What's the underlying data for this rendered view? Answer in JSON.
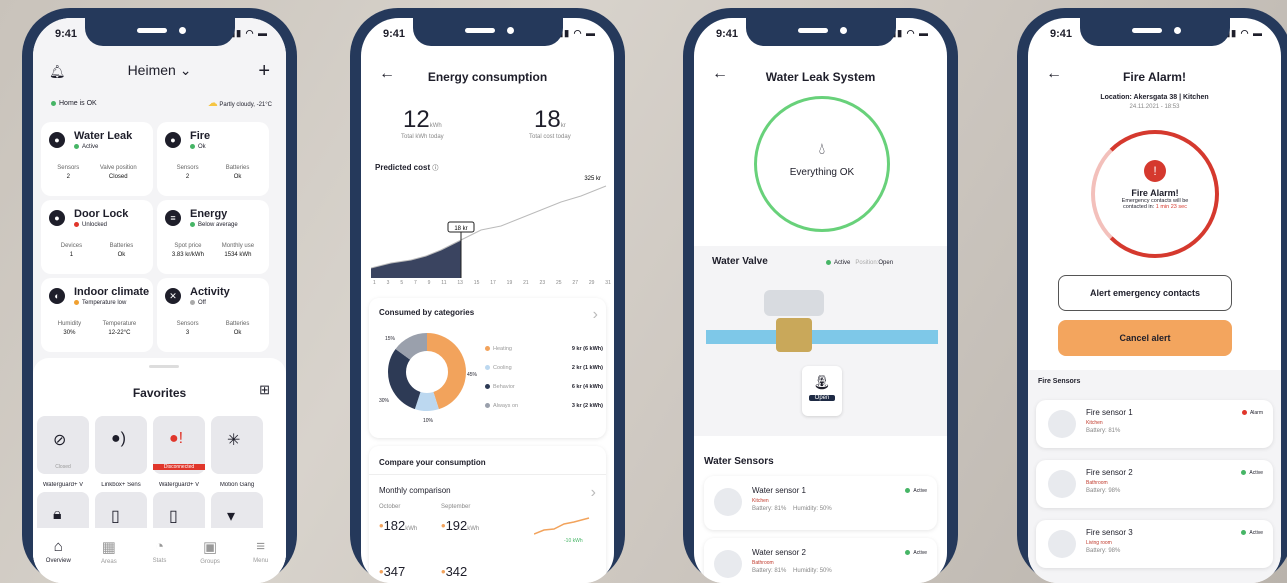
{
  "status_time": "9:41",
  "p1": {
    "title": "Heimen",
    "home": "Home is OK",
    "weather": "Partly cloudy, -21°C",
    "tiles": [
      {
        "name": "Water Leak",
        "status": "Active",
        "color": "#46b566",
        "c1": "Sensors",
        "v1": "2",
        "c2": "Valve position",
        "v2": "Closed",
        "icon": "water-drop-icon",
        "glyph": "●"
      },
      {
        "name": "Fire",
        "status": "Ok",
        "color": "#46b566",
        "c1": "Sensors",
        "v1": "2",
        "c2": "Batteries",
        "v2": "Ok",
        "icon": "fire-icon",
        "glyph": "●"
      },
      {
        "name": "Door Lock",
        "status": "Unlocked",
        "color": "#e0362b",
        "c1": "Devices",
        "v1": "1",
        "c2": "Batteries",
        "v2": "Ok",
        "icon": "lock-icon",
        "glyph": "●"
      },
      {
        "name": "Energy",
        "status": "Below average",
        "color": "#46b566",
        "c1": "Spot price",
        "v1": "3.83 kr/kWh",
        "c2": "Monthly use",
        "v2": "1534 kWh",
        "icon": "energy-icon",
        "glyph": "≡"
      },
      {
        "name": "Indoor climate",
        "status": "Temperature low",
        "color": "#f0a030",
        "c1": "Humidity",
        "v1": "30%",
        "c2": "Temperature",
        "v2": "12-22°C",
        "icon": "climate-icon",
        "glyph": "◐"
      },
      {
        "name": "Activity",
        "status": "Off",
        "color": "#aaaaaa",
        "c1": "Sensors",
        "v1": "3",
        "c2": "Batteries",
        "v2": "Ok",
        "icon": "activity-icon",
        "glyph": "✕"
      }
    ],
    "favorites_title": "Favorites",
    "favs": [
      {
        "label": "Waterguard+ V",
        "sub": "Closed"
      },
      {
        "label": "Linkbox+ Sens",
        "sub": ""
      },
      {
        "label": "Waterguard+ V",
        "sub": "Disconnected"
      },
      {
        "label": "Motion Gang",
        "sub": ""
      }
    ],
    "nav": [
      "Overview",
      "Areas",
      "Stats",
      "Groups",
      "Menu"
    ]
  },
  "p2": {
    "title": "Energy consumption",
    "kwh": "12",
    "kwh_unit": "kWh",
    "kwh_label": "Total kWh today",
    "kr": "18",
    "kr_unit": "kr",
    "kr_label": "Total cost today",
    "predicted": "Predicted cost",
    "max_label": "325 kr",
    "cur_label": "18 kr",
    "xticks": [
      "1",
      "3",
      "5",
      "7",
      "9",
      "11",
      "13",
      "15",
      "17",
      "19",
      "21",
      "23",
      "25",
      "27",
      "29",
      "31"
    ],
    "cat_title": "Consumed by categories",
    "cats": [
      {
        "name": "Heating",
        "val": "9 kr (6 kWh)",
        "pct": "45%",
        "color": "#f2a35c"
      },
      {
        "name": "Cooling",
        "val": "2 kr (1 kWh)",
        "pct": "10%",
        "color": "#bcd8f0"
      },
      {
        "name": "Behavior",
        "val": "6 kr (4 kWh)",
        "pct": "30%",
        "color": "#2d3a55"
      },
      {
        "name": "Always on",
        "val": "3 kr (2 kWh)",
        "pct": "15%",
        "color": "#9aa0ac"
      }
    ],
    "compare_title": "Compare your consumption",
    "monthly": "Monthly comparison",
    "m1": "October",
    "m2": "September",
    "v1": "182",
    "v2": "192",
    "unit": "kWh",
    "diff": "-10 kWh",
    "v3": "347",
    "v4": "342"
  },
  "p3": {
    "title": "Water Leak System",
    "ok": "Everything OK",
    "valve": "Water Valve",
    "active": "Active",
    "position_label": "Position:",
    "position": "Open",
    "open_btn": "Open",
    "sensors_title": "Water Sensors",
    "sensors": [
      {
        "name": "Water sensor 1",
        "room": "Kitchen",
        "battery": "Battery: 81%",
        "humidity": "Humidity: 50%",
        "status": "Active"
      },
      {
        "name": "Water sensor 2",
        "room": "Bathroom",
        "battery": "Battery: 81%",
        "humidity": "Humidity: 50%",
        "status": "Active"
      }
    ]
  },
  "p4": {
    "title": "Fire Alarm!",
    "location": "Location: Akersgata 38 | Kitchen",
    "datetime": "24.11.2021 - 18:53",
    "alarm": "Fire Alarm!",
    "msg": "Emergency contacts will be contacted in:",
    "countdown": "1 min 23 sec",
    "alert_btn": "Alert emergency contacts",
    "cancel_btn": "Cancel alert",
    "sensors_title": "Fire Sensors",
    "sensors": [
      {
        "name": "Fire sensor 1",
        "room": "Kitchen",
        "battery": "Battery: 81%",
        "status": "Alarm",
        "color": "#e0362b"
      },
      {
        "name": "Fire sensor 2",
        "room": "Bathroom",
        "battery": "Battery: 98%",
        "status": "Active",
        "color": "#46b566"
      },
      {
        "name": "Fire sensor 3",
        "room": "Living room",
        "battery": "Battery: 98%",
        "status": "Active",
        "color": "#46b566"
      }
    ]
  }
}
